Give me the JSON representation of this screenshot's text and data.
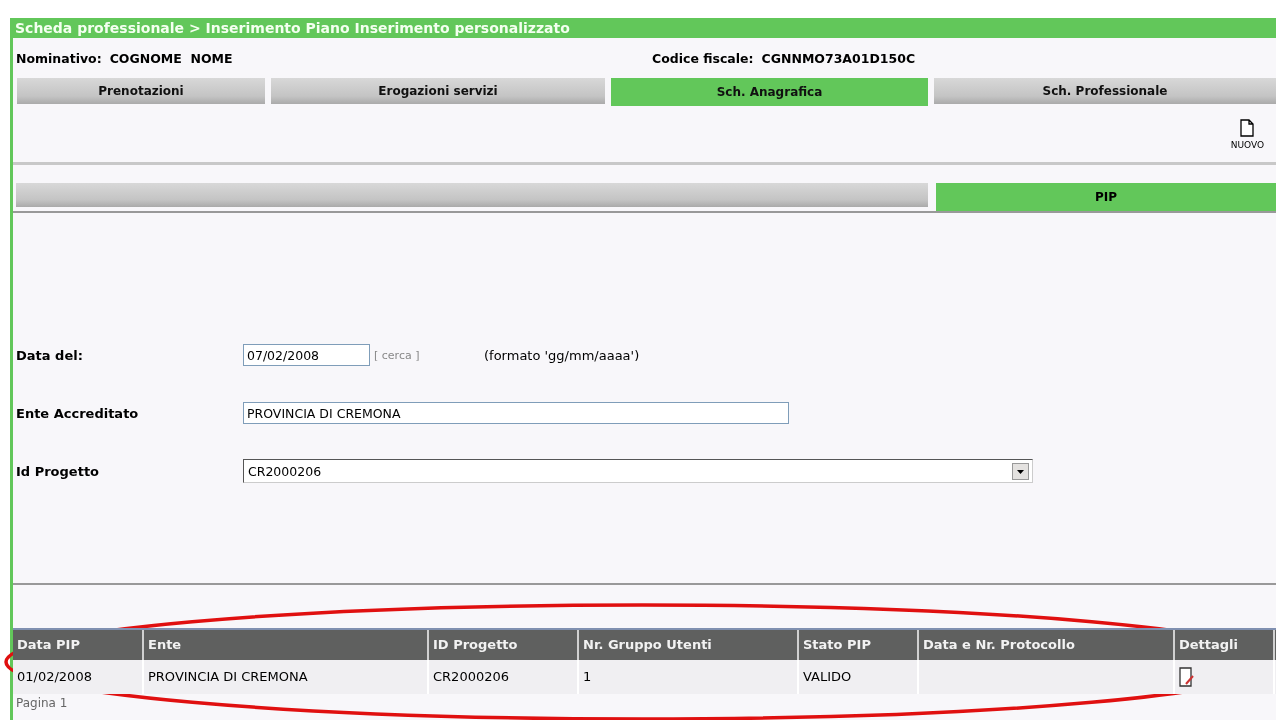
{
  "title": "Scheda professionale > Inserimento Piano Inserimento personalizzato",
  "info": [
    {
      "label": "Nominativo:",
      "value": "COGNOME  NOME"
    },
    {
      "label": "Codice fiscale:",
      "value": "CGNNMO73A01D150C"
    }
  ],
  "tabs": [
    {
      "label": "Prenotazioni",
      "selected": false
    },
    {
      "label": "Erogazioni servizi",
      "selected": false
    },
    {
      "label": "Sch. Anagrafica",
      "selected": true
    },
    {
      "label": "Sch. Professionale",
      "selected": false
    }
  ],
  "toolbar": {
    "new_label": "NUOVO"
  },
  "subtabs": [
    {
      "label": "PIP",
      "selected": true
    }
  ],
  "form": {
    "date": {
      "label": "Data del:",
      "value": "07/02/2008",
      "search_link": "[ cerca ]",
      "hint": "(formato 'gg/mm/aaaa')"
    },
    "ente": {
      "label": "Ente Accreditato",
      "value": "PROVINCIA DI CREMONA"
    },
    "progetto": {
      "label": "Id Progetto",
      "value": "CR2000206"
    }
  },
  "table": {
    "columns": [
      "Data PIP",
      "Ente",
      "ID Progetto",
      "Nr. Gruppo Utenti",
      "Stato PIP",
      "Data e Nr. Protocollo",
      "Dettagli"
    ],
    "rows": [
      {
        "cells": [
          "01/02/2008",
          "PROVINCIA DI CREMONA",
          "CR2000206",
          "1",
          "VALIDO",
          ""
        ]
      }
    ],
    "pager": "Pagina 1"
  }
}
